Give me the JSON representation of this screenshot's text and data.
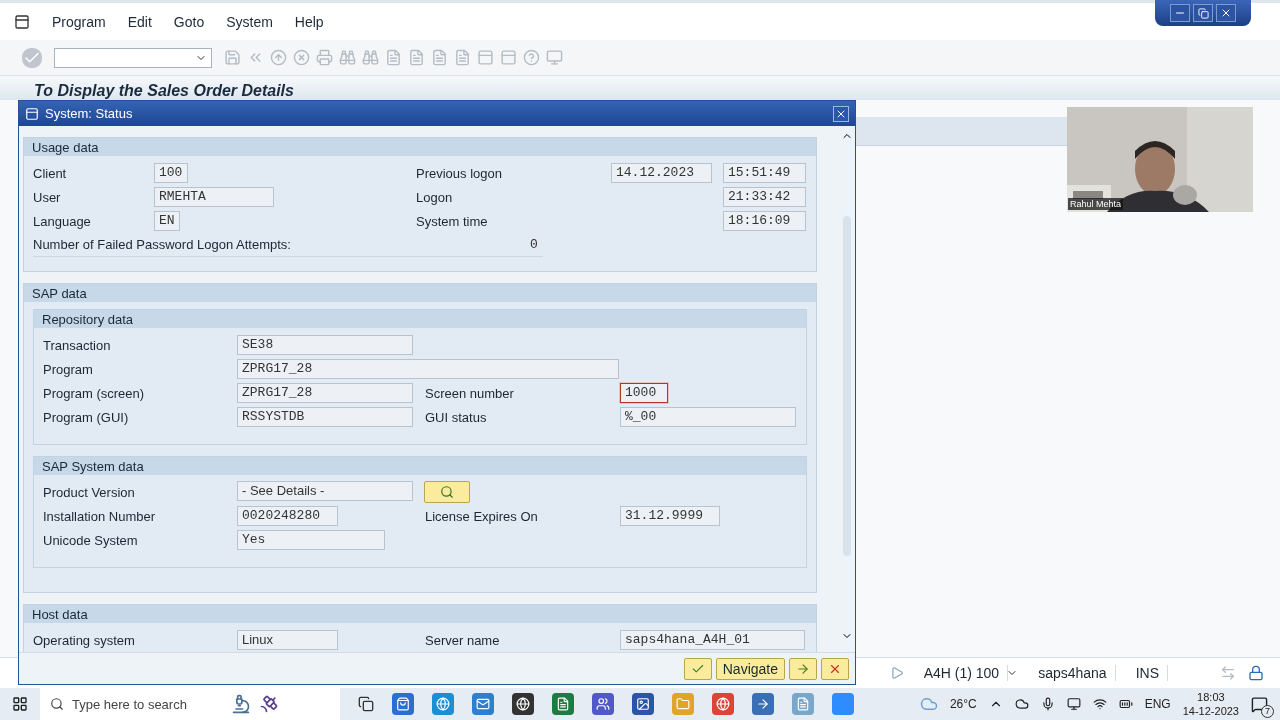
{
  "menu_bar": {
    "items": [
      "Program",
      "Edit",
      "Goto",
      "System",
      "Help"
    ]
  },
  "page_title": "To Display the Sales Order Details",
  "dialog": {
    "title": "System: Status",
    "sections": [
      {
        "title": "Usage data",
        "groups": [
          {
            "rows": [
              {
                "left": {
                  "label": "Client",
                  "fields": [
                    {
                      "value": "100",
                      "kind": "box"
                    }
                  ]
                },
                "right": {
                  "label": "Previous logon",
                  "fields": [
                    {
                      "value": "14.12.2023",
                      "kind": "box"
                    },
                    {
                      "value": "15:51:49",
                      "kind": "box"
                    }
                  ]
                }
              },
              {
                "left": {
                  "label": "User",
                  "fields": [
                    {
                      "value": "RMEHTA",
                      "kind": "box"
                    }
                  ]
                },
                "right": {
                  "label": "Logon",
                  "fields": [
                    {
                      "value": "21:33:42",
                      "kind": "box"
                    }
                  ]
                }
              },
              {
                "left": {
                  "label": "Language",
                  "fields": [
                    {
                      "value": "EN",
                      "kind": "box"
                    }
                  ]
                },
                "right": {
                  "label": "System time",
                  "fields": [
                    {
                      "value": "18:16:09",
                      "kind": "box"
                    }
                  ]
                }
              },
              {
                "left": {
                  "label": "Number of Failed Password Logon Attempts:",
                  "fields": [
                    {
                      "value": "0",
                      "kind": "plain"
                    }
                  ]
                }
              }
            ]
          }
        ]
      },
      {
        "title": "SAP data",
        "groups": [
          {
            "title": "Repository data",
            "rows": [
              {
                "left": {
                  "label": "Transaction",
                  "fields": [
                    {
                      "value": "SE38",
                      "kind": "box"
                    }
                  ]
                }
              },
              {
                "left": {
                  "label": "Program",
                  "fields": [
                    {
                      "value": "ZPRG17_28",
                      "kind": "box"
                    }
                  ]
                }
              },
              {
                "left": {
                  "label": "Program (screen)",
                  "fields": [
                    {
                      "value": "ZPRG17_28",
                      "kind": "box"
                    }
                  ]
                },
                "right": {
                  "label": "Screen number",
                  "fields": [
                    {
                      "value": "1000",
                      "kind": "box",
                      "focused": true
                    }
                  ]
                }
              },
              {
                "left": {
                  "label": "Program (GUI)",
                  "fields": [
                    {
                      "value": "RSSYSTDB",
                      "kind": "box"
                    }
                  ]
                },
                "right": {
                  "label": "GUI status",
                  "fields": [
                    {
                      "value": "%_00",
                      "kind": "box"
                    }
                  ]
                }
              }
            ]
          },
          {
            "title": "SAP System data",
            "rows": [
              {
                "left": {
                  "label": "Product Version",
                  "fields": [
                    {
                      "value": "- See Details -",
                      "kind": "text"
                    },
                    {
                      "kind": "button"
                    }
                  ]
                }
              },
              {
                "left": {
                  "label": "Installation Number",
                  "fields": [
                    {
                      "value": "0020248280",
                      "kind": "box"
                    }
                  ]
                },
                "right": {
                  "label": "License Expires On",
                  "fields": [
                    {
                      "value": "31.12.9999",
                      "kind": "box"
                    }
                  ]
                }
              },
              {
                "left": {
                  "label": "Unicode System",
                  "fields": [
                    {
                      "value": "Yes",
                      "kind": "box"
                    }
                  ]
                }
              }
            ]
          }
        ]
      },
      {
        "title": "Host data",
        "groups": [
          {
            "rows": [
              {
                "left": {
                  "label": "Operating system",
                  "fields": [
                    {
                      "value": "Linux",
                      "kind": "text"
                    }
                  ]
                },
                "right": {
                  "label": "Server name",
                  "fields": [
                    {
                      "value": "saps4hana_A4H_01",
                      "kind": "box"
                    }
                  ]
                }
              }
            ]
          }
        ]
      }
    ],
    "buttons": [
      {
        "kind": "ok"
      },
      {
        "kind": "text",
        "label": "Navigate"
      },
      {
        "kind": "forward"
      },
      {
        "kind": "cancel"
      }
    ]
  },
  "video": {
    "caption": "Rahul Mehta"
  },
  "status_bar": {
    "system": "A4H (1) 100",
    "server": "saps4hana",
    "mode": "INS"
  },
  "taskbar": {
    "search_placeholder": "Type here to search",
    "weather": "26°C",
    "language": "ENG",
    "time": "18:03",
    "date": "14-12-2023",
    "notifications": "7"
  }
}
